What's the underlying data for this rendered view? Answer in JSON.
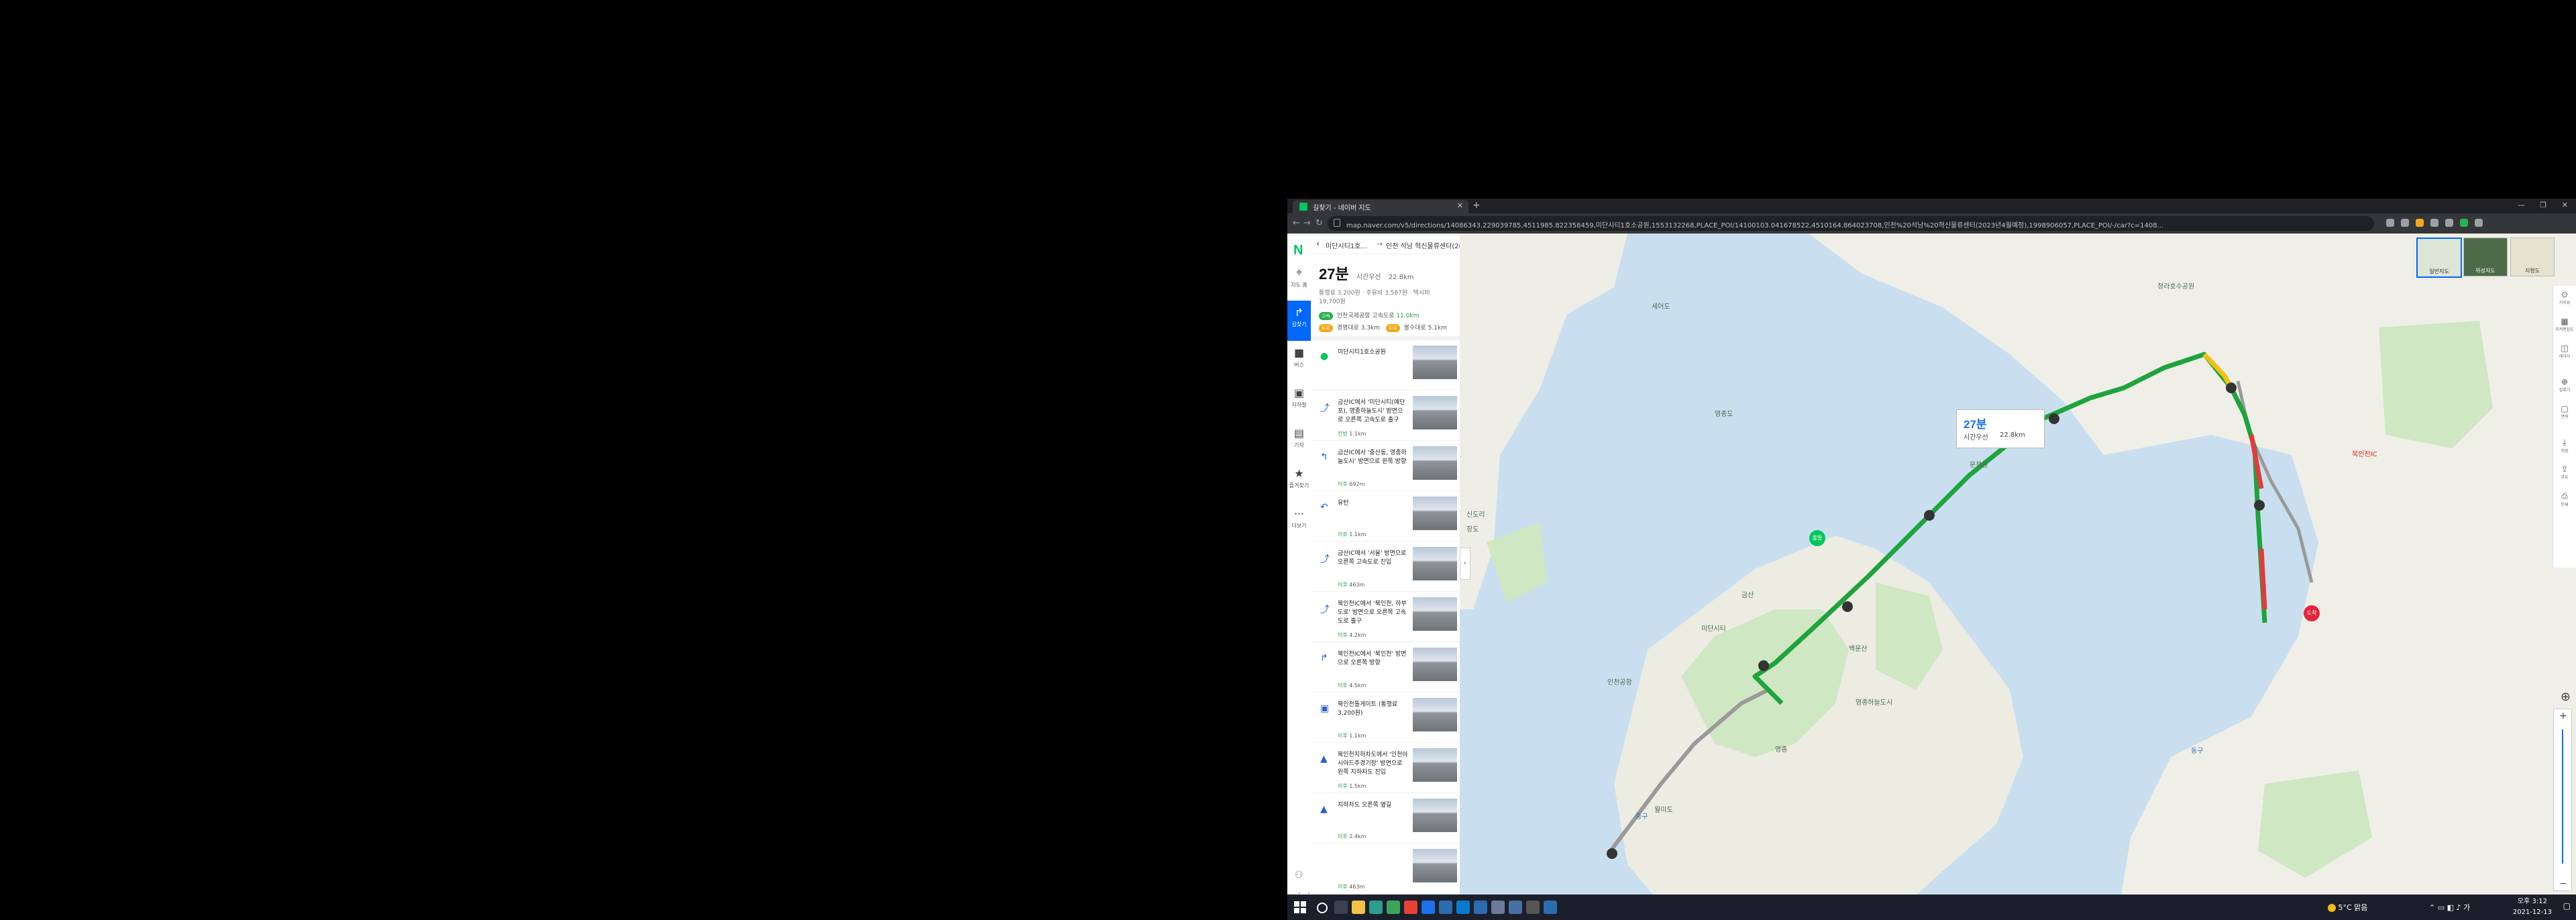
{
  "browser": {
    "tab_title": "길찾기 - 네이버 지도",
    "url": "map.naver.com/v5/directions/14086343.229039785,4511985.822358459,미단시티1호소공원,1553132268,PLACE_POI/14100103.041678522,4510164.864023708,인천%20석남%20혁신물류센터(2023년4월예정),1998906057,PLACE_POI/-/car?c=1408..."
  },
  "left_nav": {
    "logo": "N",
    "items": [
      {
        "label": "지도 홈",
        "icon": "map-pin-icon"
      },
      {
        "label": "길찾기",
        "icon": "directions-icon",
        "active": true
      },
      {
        "label": "버스",
        "icon": "bus-icon"
      },
      {
        "label": "지하철",
        "icon": "subway-icon"
      },
      {
        "label": "기차",
        "icon": "train-icon"
      },
      {
        "label": "즐겨찾기",
        "icon": "star-icon"
      },
      {
        "label": "더보기",
        "icon": "more-icon"
      }
    ]
  },
  "route": {
    "from": "미단시티1호...",
    "to": "인천 석남 혁신물류센터(2023...",
    "time": "27분",
    "mode": "시간우선",
    "distance": "22.8km",
    "fees": "통행료 3,200원 · 주유비 3,587원 · 택시비 19,700원",
    "road1_tag": "고속",
    "road1": "인천국제공항 고속도로",
    "road1_km": "11.0km",
    "road2_tag": "도로",
    "road2": "경명대로 3.3km",
    "road3_tag": "도로",
    "road3": "봉수대로 5.1km"
  },
  "steps": [
    {
      "text": "미단시티1호소공원",
      "dist_label": "",
      "dist": "",
      "icon": "start-pin-icon"
    },
    {
      "text": "금산IC에서 '미단시티(예단포), 영종하늘도시' 방면으로 오른쪽 고속도로 출구",
      "dist_label": "전방",
      "dist": "1.1km",
      "icon": "exit-icon"
    },
    {
      "text": "금산IC에서 '중산동, 영종하늘도시' 방면으로 왼쪽 방향",
      "dist_label": "이후",
      "dist": "692m",
      "icon": "left-turn-icon"
    },
    {
      "text": "유턴",
      "dist_label": "이후",
      "dist": "1.1km",
      "icon": "u-turn-icon"
    },
    {
      "text": "금산IC에서 '서울' 방면으로 오른쪽 고속도로 진입",
      "dist_label": "이후",
      "dist": "463m",
      "icon": "exit-icon"
    },
    {
      "text": "북인천IC에서 '북인천, 하부도로' 방면으로 오른쪽 고속도로 출구",
      "dist_label": "이후",
      "dist": "4.2km",
      "icon": "exit-icon"
    },
    {
      "text": "북인천IC에서 '북인천' 방면으로 오른쪽 방향",
      "dist_label": "이후",
      "dist": "4.5km",
      "icon": "right-turn-icon"
    },
    {
      "text": "북인천톨게이트 (통행료 3,200원)",
      "dist_label": "이후",
      "dist": "1.1km",
      "icon": "toll-icon"
    },
    {
      "text": "북인천지하차도에서 '인천아시아드주경기장' 방면으로 왼쪽 지하차도 진입",
      "dist_label": "이후",
      "dist": "1.5km",
      "icon": "tunnel-icon"
    },
    {
      "text": "지하차도 오른쪽 옆길",
      "dist_label": "이후",
      "dist": "2.4km",
      "icon": "tunnel-icon"
    },
    {
      "text": "",
      "dist_label": "이후",
      "dist": "463m",
      "icon": ""
    }
  ],
  "map": {
    "bubble_time": "27분",
    "bubble_mode": "시간우선",
    "bubble_distance": "22.8km",
    "start_pin": "출발",
    "end_pin": "도착",
    "map_types": [
      "일반지도",
      "위성지도",
      "지형도"
    ],
    "tools": [
      "거리뷰",
      "지적편집도",
      "레이어",
      "길찾기",
      "면적",
      "저장",
      "공유",
      "인쇄"
    ],
    "labels": [
      "세어도",
      "청라호수공원",
      "영종도",
      "운북동",
      "신도리",
      "장도",
      "금산",
      "백운산",
      "영종하늘도시",
      "영종",
      "동구",
      "중구",
      "월미도",
      "북인천IC",
      "인천공항",
      "미단시티"
    ],
    "scale": "500m"
  },
  "taskbar": {
    "weather": "5°C 맑음",
    "time": "오후 3:12",
    "date": "2021-12-13"
  }
}
